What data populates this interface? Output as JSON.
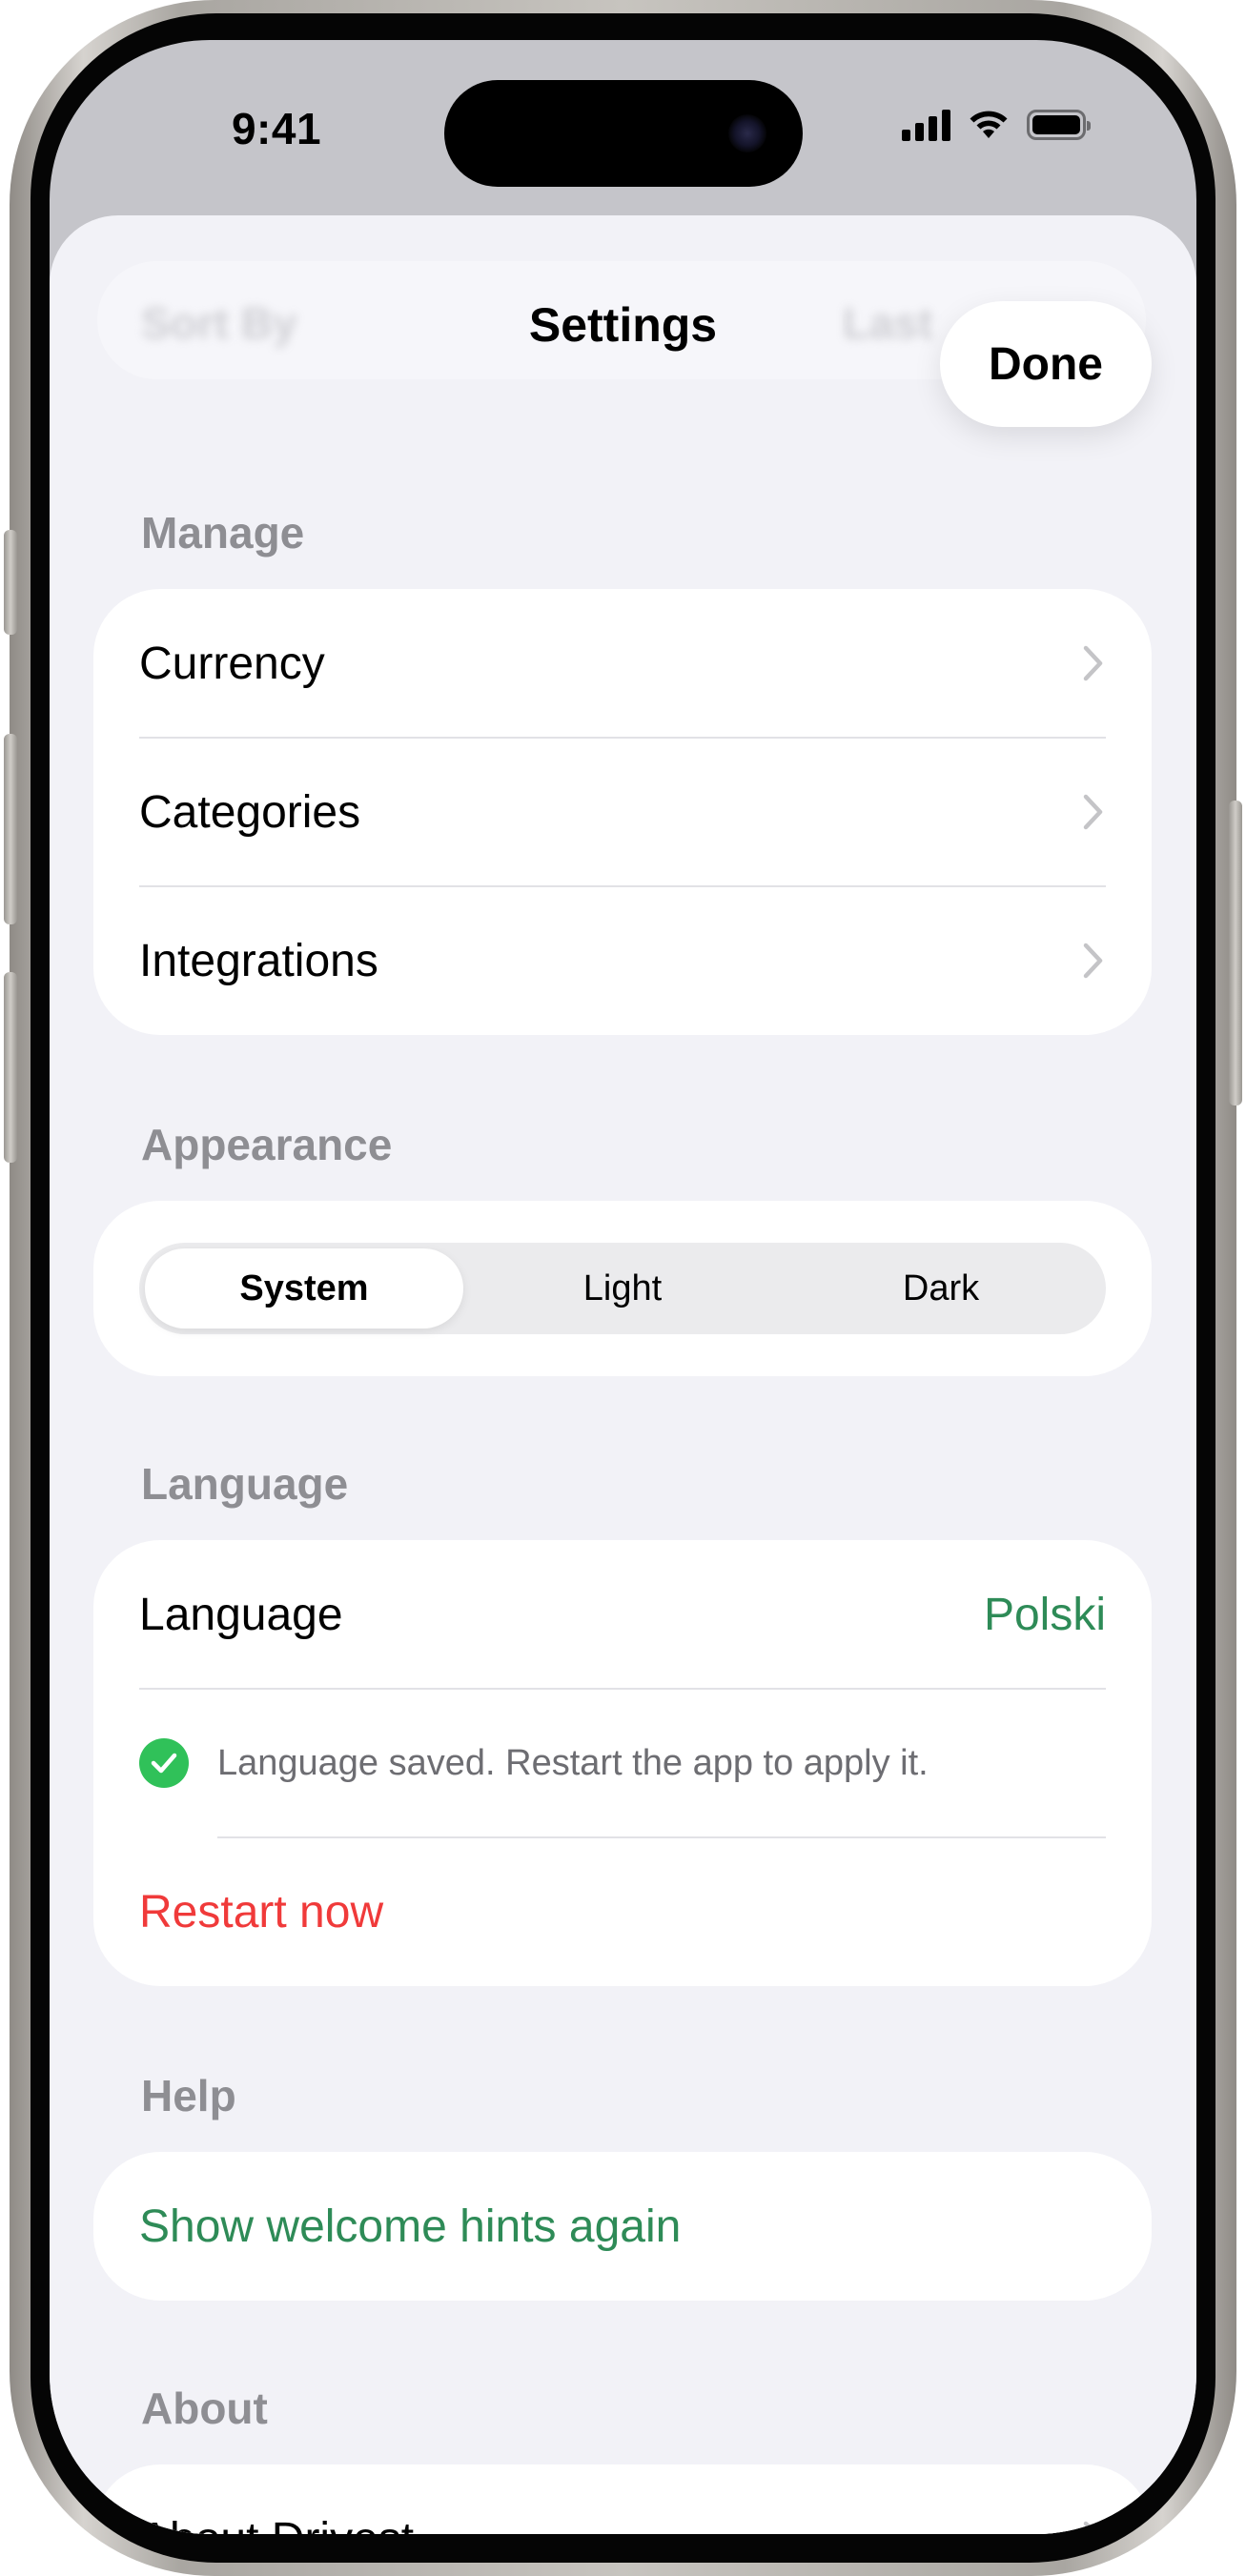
{
  "status_bar": {
    "time": "9:41",
    "icons": [
      "cellular-signal-icon",
      "wifi-icon",
      "battery-icon"
    ]
  },
  "nav": {
    "title": "Settings",
    "done_label": "Done",
    "background_left": "Sort By",
    "background_right": "Last"
  },
  "sections": {
    "manage": {
      "header": "Manage",
      "items": [
        {
          "label": "Currency"
        },
        {
          "label": "Categories"
        },
        {
          "label": "Integrations"
        }
      ]
    },
    "appearance": {
      "header": "Appearance",
      "options": [
        "System",
        "Light",
        "Dark"
      ],
      "selected": "System"
    },
    "language": {
      "header": "Language",
      "row_label": "Language",
      "row_value": "Polski",
      "notice": "Language saved. Restart the app to apply it.",
      "restart_label": "Restart now"
    },
    "help": {
      "header": "Help",
      "hints_label": "Show welcome hints again"
    },
    "about": {
      "header": "About",
      "about_label": "About Drivest"
    }
  },
  "colors": {
    "accent_green": "#2e8b57",
    "destructive_red": "#f03a3a",
    "success_check": "#30c159",
    "grouped_background": "#f2f2f7"
  }
}
